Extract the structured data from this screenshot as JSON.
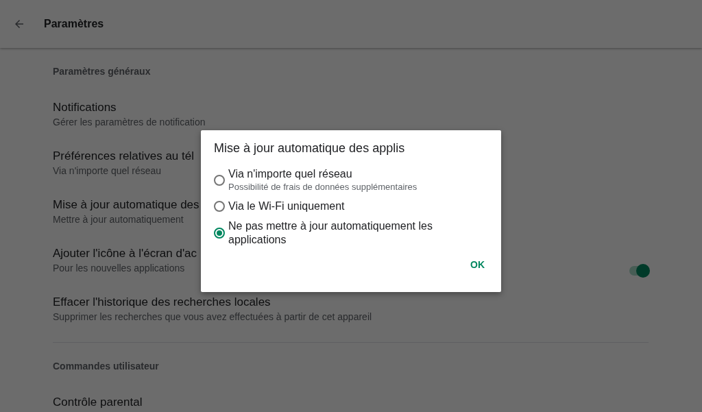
{
  "app_bar": {
    "title": "Paramètres"
  },
  "sections": [
    {
      "title": "Paramètres généraux",
      "items": [
        {
          "kind": "plain",
          "title": "Notifications",
          "subtitle": "Gérer les paramètres de notification"
        },
        {
          "kind": "plain",
          "title": "Préférences relatives au tél",
          "subtitle": "Via n'importe quel réseau"
        },
        {
          "kind": "plain",
          "title": "Mise à jour automatique des",
          "subtitle": "Mettre à jour automatiquement"
        },
        {
          "kind": "switch",
          "title": "Ajouter l'icône à l'écran d'ac",
          "subtitle": "Pour les nouvelles applications",
          "on": true
        },
        {
          "kind": "plain",
          "title": "Effacer l'historique des recherches locales",
          "subtitle": "Supprimer les recherches que vous avez effectuées à partir de cet appareil"
        }
      ]
    },
    {
      "title": "Commandes utilisateur",
      "items": [
        {
          "kind": "plain",
          "title": "Contrôle parental"
        }
      ]
    }
  ],
  "dialog": {
    "title": "Mise à jour automatique des applis",
    "options": [
      {
        "label": "Via n'importe quel réseau",
        "description": "Possibilité de frais de données supplémentaires",
        "selected": false
      },
      {
        "label": "Via le Wi-Fi uniquement",
        "selected": false
      },
      {
        "label": "Ne pas mettre à jour automatiquement les applications",
        "selected": true
      }
    ],
    "button": "OK"
  }
}
